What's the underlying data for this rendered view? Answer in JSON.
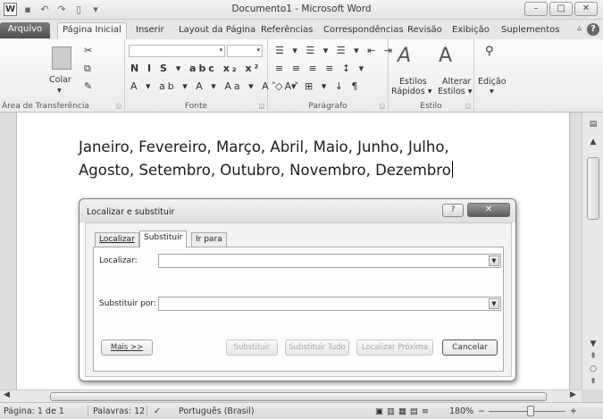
{
  "window": {
    "title": "Documento1 - Microsoft Word"
  },
  "quick_access": {
    "icons": [
      "word-logo",
      "save-icon",
      "undo-icon",
      "redo-icon",
      "new-doc-icon",
      "qat-menu-icon"
    ],
    "logo_letter": "W"
  },
  "ribbon_tabs": [
    {
      "label": "Arquivo"
    },
    {
      "label": "Página Inicial",
      "active": true
    },
    {
      "label": "Inserir"
    },
    {
      "label": "Layout da Página"
    },
    {
      "label": "Referências"
    },
    {
      "label": "Correspondências"
    },
    {
      "label": "Revisão"
    },
    {
      "label": "Exibição"
    },
    {
      "label": "Suplementos"
    }
  ],
  "ribbon": {
    "groups": {
      "clipboard": "Área de Transferência",
      "font": "Fonte",
      "paragraph": "Parágrafo",
      "style": "Estilo"
    },
    "buttons": {
      "paste": "Colar",
      "quick_styles_1": "Estilos",
      "quick_styles_2": "Rápidos ▾",
      "change_styles_1": "Alterar",
      "change_styles_2": "Estilos ▾",
      "editing": "Edição"
    },
    "font_row1": "N  I  S ▾ abc x₂ x²",
    "font_row2": "A ▾ ab ▾ A ▾ Aa ▾  A˄ A˅",
    "para_row1": "☰ ▾ ☰ ▾ ☰ ▾   ⇤ ⇥",
    "para_row2": "≡ ≡ ≡ ≡   ↕ ▾",
    "para_row3": "◇ ▾ ⊞ ▾  ↓  ¶"
  },
  "document": {
    "lines": [
      "Janeiro, Fevereiro, Março, Abril, Maio, Junho, Julho,",
      "Agosto, Setembro, Outubro, Novembro, Dezembro"
    ]
  },
  "dialog": {
    "title": "Localizar e substituir",
    "help": "?",
    "close": "✕",
    "tabs": [
      {
        "label": "Localizar"
      },
      {
        "label": "Substituir",
        "active": true
      },
      {
        "label": "Ir para"
      }
    ],
    "find_label": "Localizar:",
    "find_value": "",
    "replace_label": "Substituir por:",
    "replace_value": "",
    "buttons": {
      "more": "Mais >>",
      "replace": "Substituir",
      "replace_all": "Substituir Tudo",
      "find_next": "Localizar Próxima",
      "cancel": "Cancelar"
    }
  },
  "status_bar": {
    "page": "Página: 1 de 1",
    "words": "Palavras: 12",
    "language": "Português (Brasil)",
    "zoom": "180%",
    "zoom_minus": "−",
    "zoom_plus": "+"
  }
}
